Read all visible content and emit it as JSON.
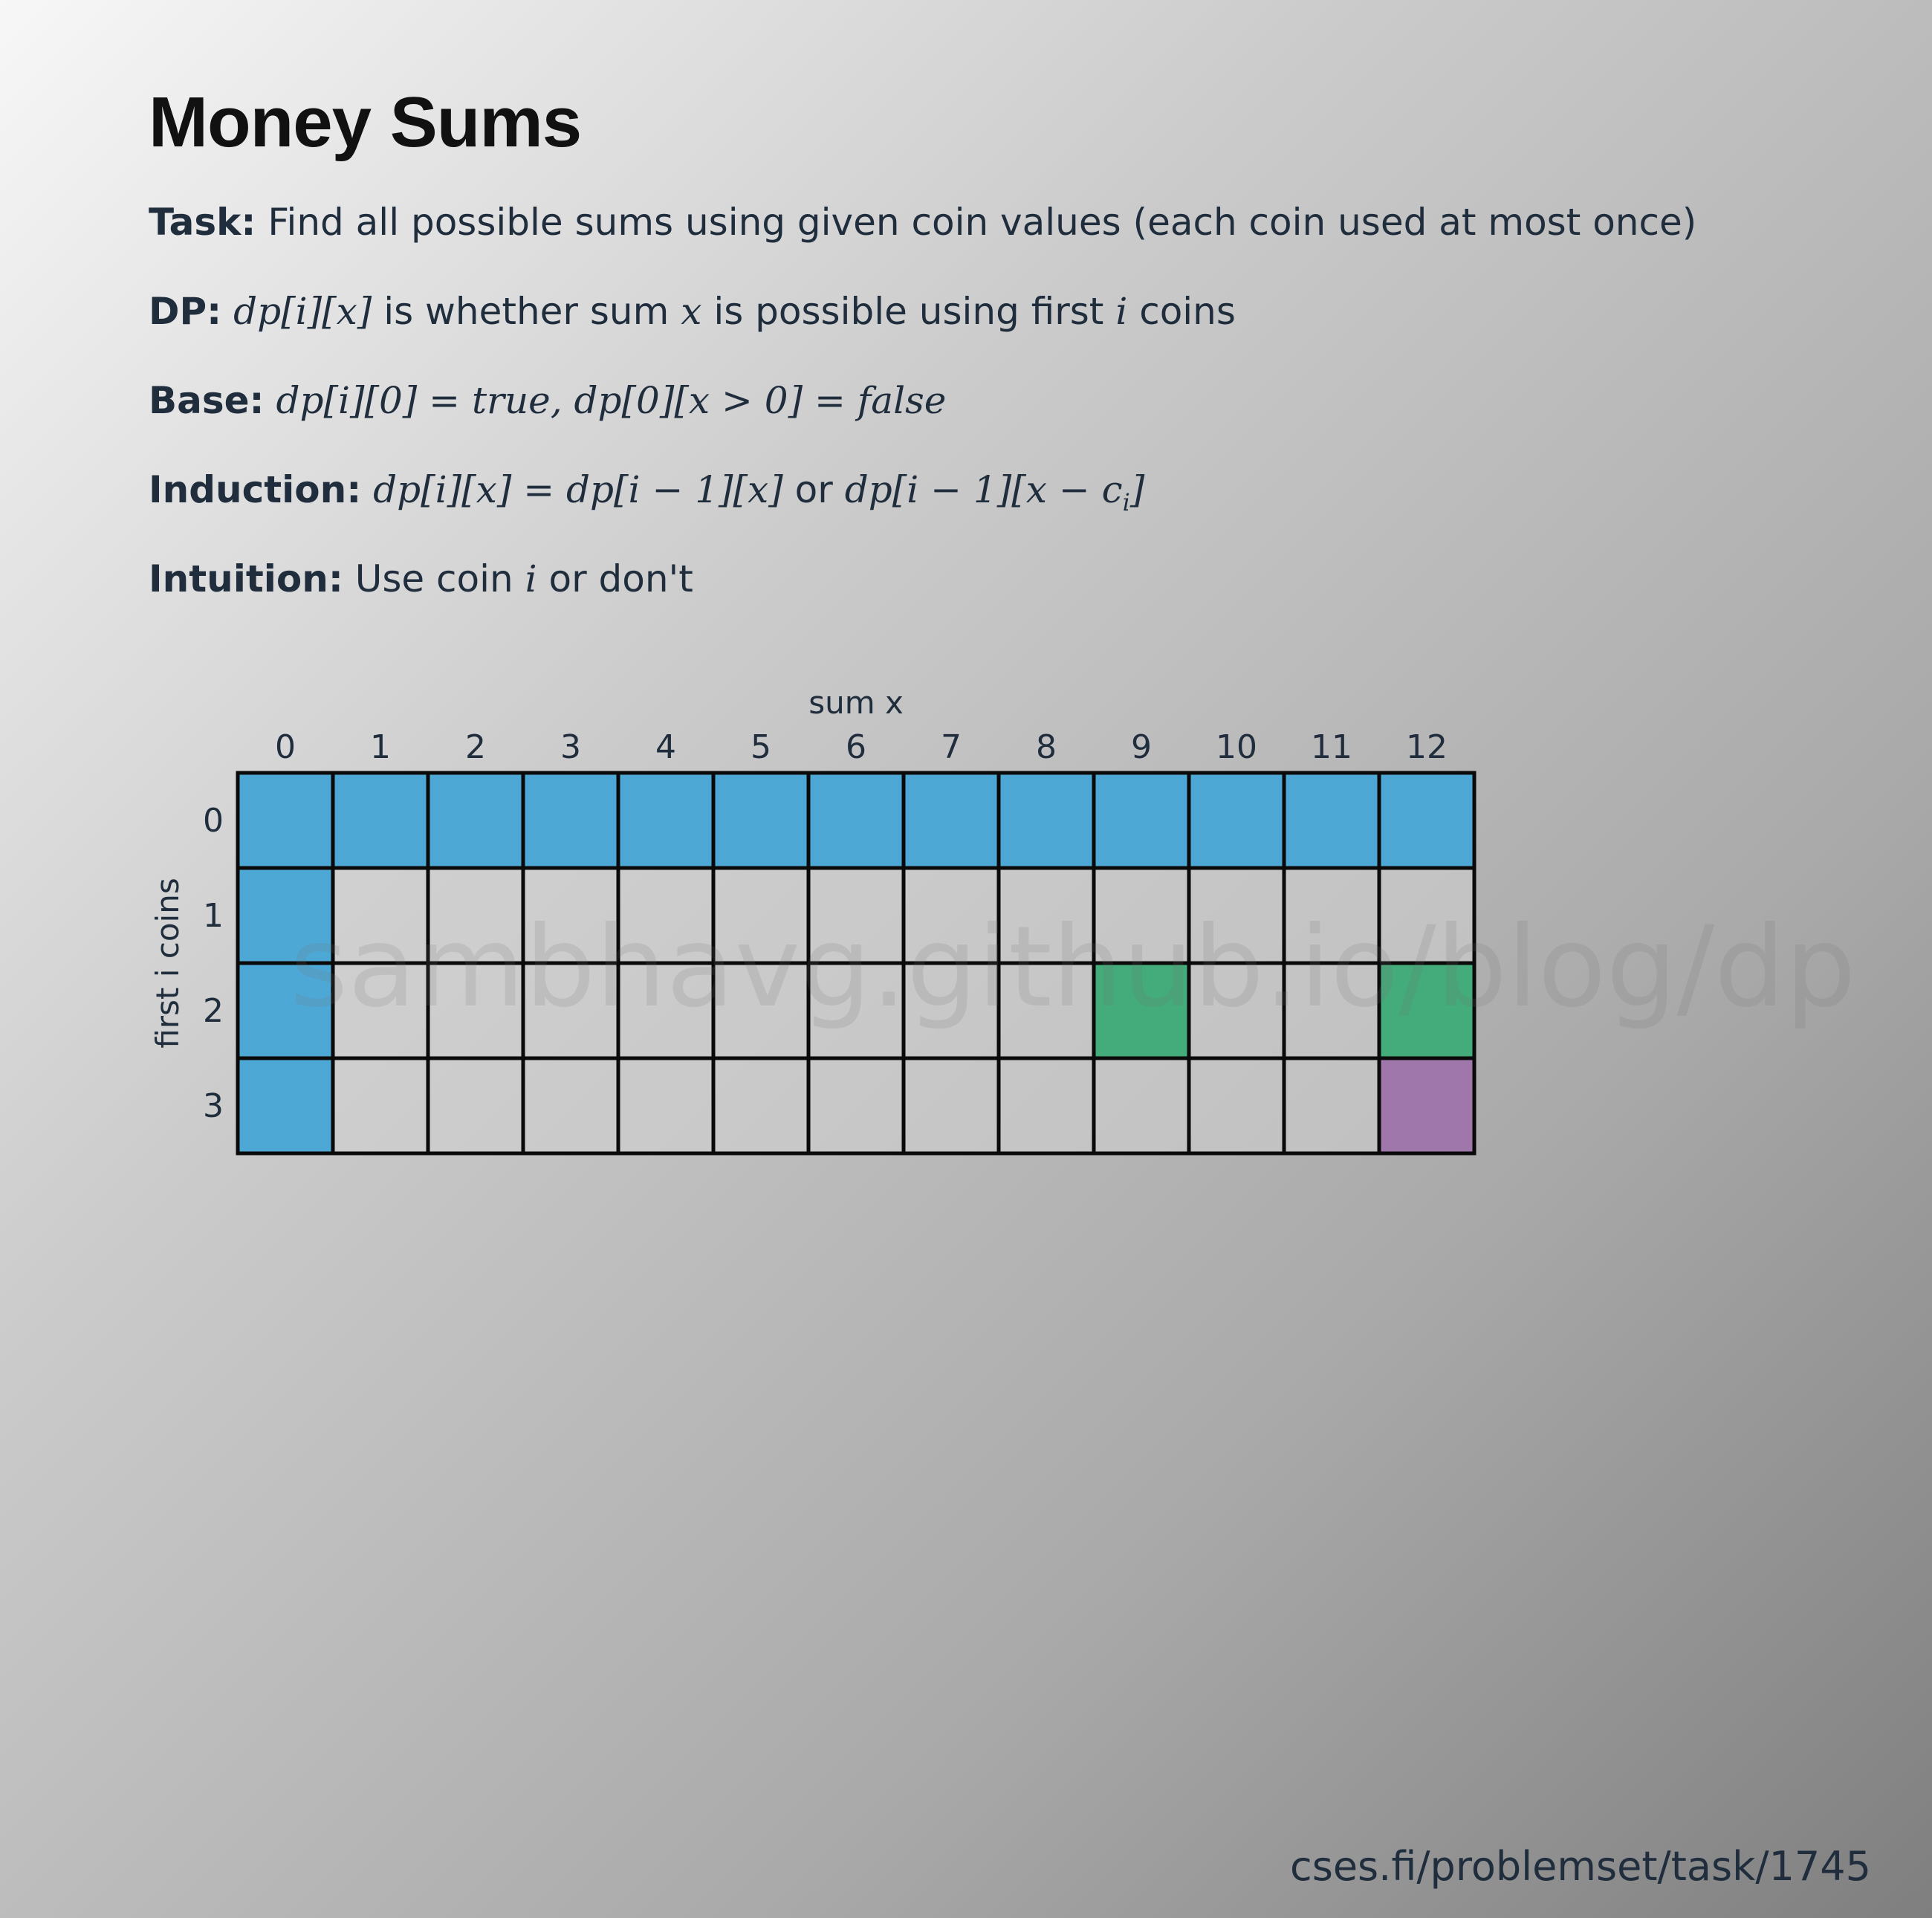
{
  "title": "Money Sums",
  "task": {
    "label": "Task:",
    "text": "Find all possible sums using given coin values (each coin used at most once)"
  },
  "dp": {
    "label": "DP:",
    "expr": "dp[i][x]",
    "text1": " is whether sum ",
    "var_x": "x",
    "text2": " is possible using first ",
    "var_i": "i",
    "text3": " coins"
  },
  "base": {
    "label": "Base:",
    "expr": "dp[i][0] = true, dp[0][x > 0] = false"
  },
  "induction": {
    "label": "Induction:",
    "expr1": "dp[i][x] = dp[i − 1][x]",
    "or": " or ",
    "expr2a": "dp[i − 1][x − c",
    "expr2_sub": "i",
    "expr2b": "]"
  },
  "intuition": {
    "label": "Intuition:",
    "text1": "Use coin ",
    "var_i": "i",
    "text2": " or don't"
  },
  "grid": {
    "x_axis_label": "sum x",
    "y_axis_label": "first i coins",
    "columns": [
      "0",
      "1",
      "2",
      "3",
      "4",
      "5",
      "6",
      "7",
      "8",
      "9",
      "10",
      "11",
      "12"
    ],
    "rows": [
      "0",
      "1",
      "2",
      "3"
    ],
    "highlights": [
      {
        "row": 0,
        "cols": [
          0,
          1,
          2,
          3,
          4,
          5,
          6,
          7,
          8,
          9,
          10,
          11,
          12
        ],
        "kind": "base"
      },
      {
        "row": 1,
        "cols": [
          0
        ],
        "kind": "base"
      },
      {
        "row": 2,
        "cols": [
          0
        ],
        "kind": "base"
      },
      {
        "row": 3,
        "cols": [
          0
        ],
        "kind": "base"
      },
      {
        "row": 2,
        "cols": [
          9,
          12
        ],
        "kind": "dependency"
      },
      {
        "row": 3,
        "cols": [
          12
        ],
        "kind": "current"
      }
    ]
  },
  "colors": {
    "base": "#4ea8d6",
    "dependency": "#44ab7a",
    "current": "#a077ab",
    "empty": "rgba(210,210,210,0.55)",
    "border": "#0a0a0a"
  },
  "watermark": "sambhavg.github.io/blog/dp",
  "footer": "cses.fi/problemset/task/1745"
}
